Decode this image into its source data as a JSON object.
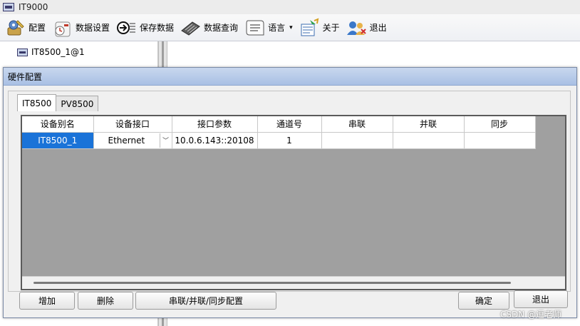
{
  "window": {
    "title": "IT9000"
  },
  "toolbar": {
    "items": [
      {
        "label": "配置",
        "icon": "gear-wrench-icon"
      },
      {
        "label": "数据设置",
        "icon": "clock-settings-icon"
      },
      {
        "label": "保存数据",
        "icon": "save-arrow-icon"
      },
      {
        "label": "数据查询",
        "icon": "keyboard-search-icon"
      },
      {
        "label": "语言",
        "icon": "scroll-language-icon",
        "has_dropdown": true,
        "dropdown_glyph": "▾"
      },
      {
        "label": "关于",
        "icon": "about-info-icon"
      },
      {
        "label": "退出",
        "icon": "exit-users-icon"
      }
    ]
  },
  "tree": {
    "node_label": "IT8500_1@1"
  },
  "dialog": {
    "title": "硬件配置",
    "tabs": [
      {
        "label": "IT8500",
        "active": true
      },
      {
        "label": "PV8500",
        "active": false
      }
    ],
    "columns": [
      "设备别名",
      "设备接口",
      "接口参数",
      "通道号",
      "串联",
      "并联",
      "同步"
    ],
    "rows": [
      {
        "alias": "IT8500_1",
        "interface": "Ethernet",
        "params": "10.0.6.143::20108",
        "channel": "1",
        "series": "",
        "parallel": "",
        "sync": ""
      }
    ],
    "interface_dropdown_glyph": "﹀",
    "buttons": {
      "add": "增加",
      "delete": "删除",
      "config": "串联/并联/同步配置",
      "ok": "确定",
      "exit": "退出"
    }
  },
  "watermark": "CSDN @逗老师",
  "colors": {
    "selection": "#1a73d8",
    "grid_empty": "#a0a0a0",
    "dialog_title": "#b8cdec"
  }
}
